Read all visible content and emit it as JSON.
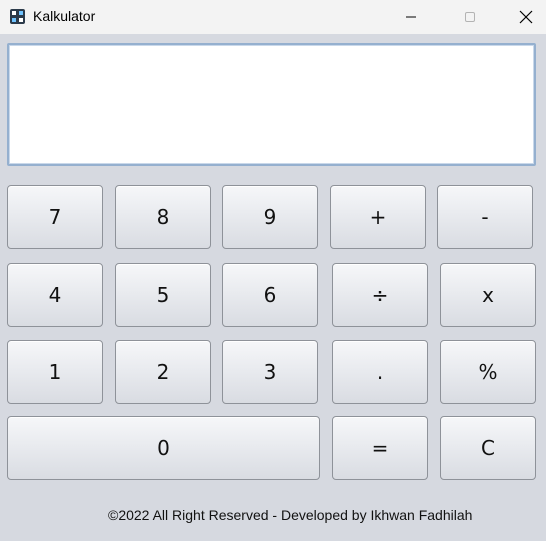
{
  "window": {
    "title": "Kalkulator",
    "icon": "calculator-app-icon",
    "controls": [
      "minimize-icon",
      "maximize-icon",
      "close-icon"
    ]
  },
  "display": {
    "value": ""
  },
  "keys": {
    "k7": "7",
    "k8": "8",
    "k9": "9",
    "plus": "+",
    "minus": "-",
    "k4": "4",
    "k5": "5",
    "k6": "6",
    "divide": "÷",
    "multiply": "x",
    "k1": "1",
    "k2": "2",
    "k3": "3",
    "dot": ".",
    "percent": "%",
    "k0": "0",
    "equals": "=",
    "clear": "C"
  },
  "footer": {
    "text": "©2022 All Right Reserved - Developed by Ikhwan Fadhilah"
  },
  "colors": {
    "background": "#d6d9e0",
    "display_border": "#95b0cf",
    "key_border": "#8e9299"
  }
}
